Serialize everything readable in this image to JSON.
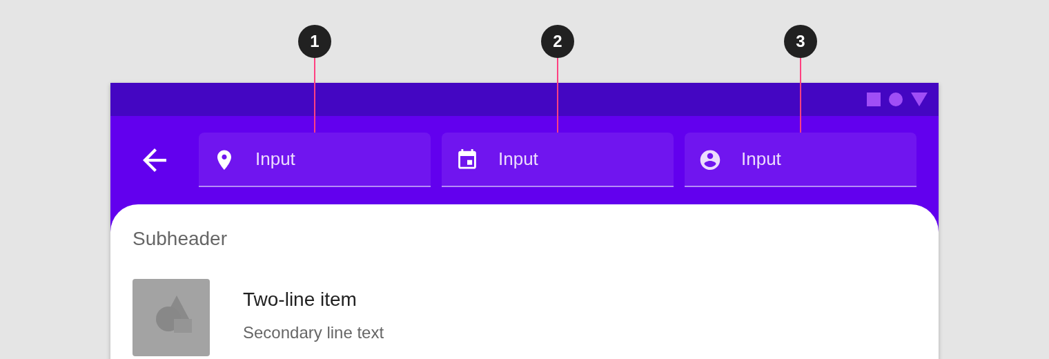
{
  "callouts": [
    "1",
    "2",
    "3"
  ],
  "fields": [
    {
      "kind": "location",
      "placeholder": "Input"
    },
    {
      "kind": "calendar",
      "placeholder": "Input"
    },
    {
      "kind": "person",
      "placeholder": "Input"
    }
  ],
  "list": {
    "subheader": "Subheader",
    "items": [
      {
        "kind": "picture",
        "title": "Two-line item",
        "secondary": "Secondary line text"
      }
    ]
  }
}
